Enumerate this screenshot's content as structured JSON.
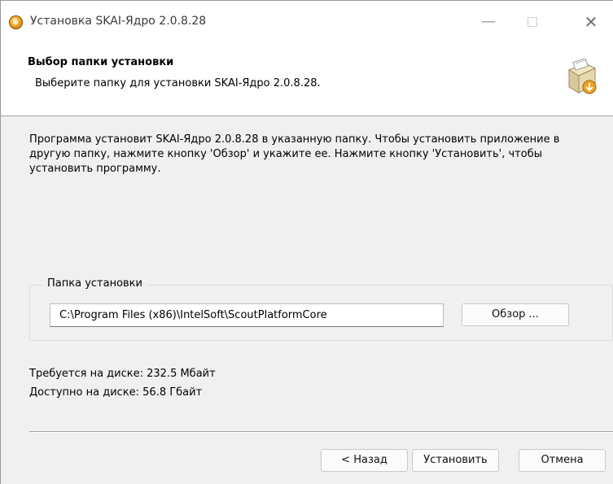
{
  "window": {
    "title": "Установка SKAI-Ядро 2.0.8.28",
    "minimize_glyph": "—",
    "close_glyph": "✕"
  },
  "header": {
    "title": "Выбор папки установки",
    "subtitle": "Выберите папку для установки SKAI-Ядро 2.0.8.28.",
    "icon": "installer-box-icon"
  },
  "main": {
    "description": "Программа установит SKAI-Ядро 2.0.8.28 в указанную папку. Чтобы установить приложение в другую папку, нажмите кнопку 'Обзор' и укажите ее. Нажмите кнопку 'Установить', чтобы установить программу.",
    "group_label": "Папка установки",
    "install_path": "C:\\Program Files (x86)\\IntelSoft\\ScoutPlatformCore",
    "browse_label": "Обзор ...",
    "space_required": "Требуется на диске: 232.5 Мбайт",
    "space_available": "Доступно на диске: 56.8 Гбайт"
  },
  "footer": {
    "back_label": "< Назад",
    "install_label": "Установить",
    "cancel_label": "Отмена"
  },
  "colors": {
    "header_bg": "#ffffff",
    "body_bg": "#f0f0f0",
    "app_icon": "#f0a020"
  }
}
